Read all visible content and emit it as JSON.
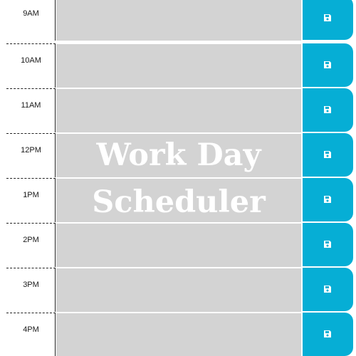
{
  "header": {
    "title_line1": "Work Day",
    "title_line2": "Scheduler"
  },
  "rows": [
    {
      "hour": "9AM",
      "task": ""
    },
    {
      "hour": "10AM",
      "task": ""
    },
    {
      "hour": "11AM",
      "task": ""
    },
    {
      "hour": "12PM",
      "task": ""
    },
    {
      "hour": "1PM",
      "task": ""
    },
    {
      "hour": "2PM",
      "task": ""
    },
    {
      "hour": "3PM",
      "task": ""
    },
    {
      "hour": "4PM",
      "task": ""
    }
  ],
  "icons": {
    "save": "floppy-disk-icon"
  },
  "colors": {
    "task_background": "#d3d3d3",
    "save_button": "#06aed5",
    "title_text": "#ffffff"
  }
}
